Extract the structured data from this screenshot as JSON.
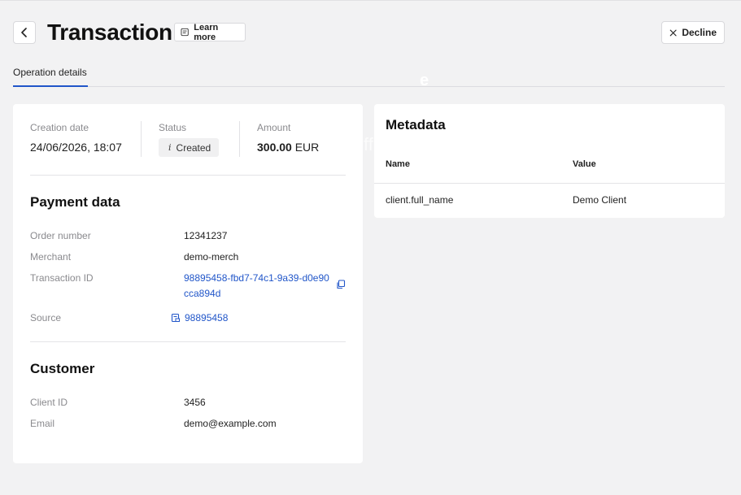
{
  "header": {
    "title": "Transaction",
    "learn_more_label": "Learn more",
    "decline_label": "Decline"
  },
  "tabs": [
    {
      "label": "Operation details",
      "active": true
    }
  ],
  "summary": {
    "creation_date_label": "Creation date",
    "creation_date_value": "24/06/2026, 18:07",
    "status_label": "Status",
    "status_value": "Created",
    "status_icon": "i",
    "amount_label": "Amount",
    "amount_value": "300.00",
    "amount_currency": "EUR"
  },
  "payment_data": {
    "title": "Payment data",
    "order_number_label": "Order number",
    "order_number_value": "12341237",
    "merchant_label": "Merchant",
    "merchant_value": "demo-merch",
    "transaction_id_label": "Transaction ID",
    "transaction_id_value": "98895458-fbd7-74c1-9a39-d0e90cca894d",
    "source_label": "Source",
    "source_value": "98895458"
  },
  "customer": {
    "title": "Customer",
    "client_id_label": "Client ID",
    "client_id_value": "3456",
    "email_label": "Email",
    "email_value": "demo@example.com"
  },
  "metadata": {
    "title": "Metadata",
    "columns": [
      "Name",
      "Value"
    ],
    "rows": [
      {
        "name": "client.full_name",
        "value": "Demo Client"
      }
    ]
  },
  "colors": {
    "accent": "#2156c9",
    "background": "#f2f2f3",
    "card": "#ffffff"
  },
  "icons": {
    "back": "chevron-left-icon",
    "learn_more": "document-icon",
    "decline": "close-icon",
    "copy": "copy-icon",
    "source": "receipt-icon"
  }
}
